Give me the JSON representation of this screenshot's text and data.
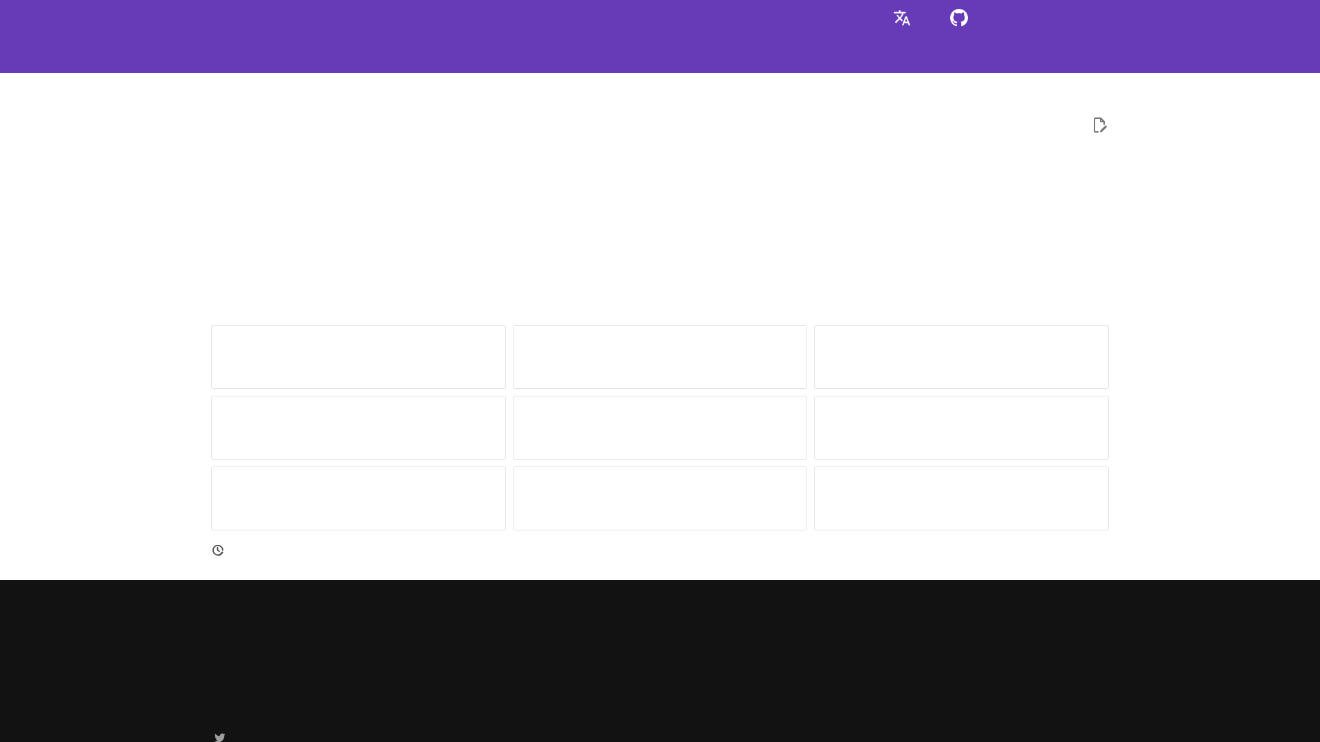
{
  "cards": [
    {
      "kind": "blank"
    },
    {
      "kind": "blank"
    },
    {
      "kind": "blank"
    },
    {
      "kind": "blank"
    },
    {
      "kind": "blank"
    },
    {
      "kind": "blank"
    },
    {
      "kind": "blank"
    },
    {
      "kind": "blank"
    },
    {
      "kind": "blank"
    }
  ]
}
